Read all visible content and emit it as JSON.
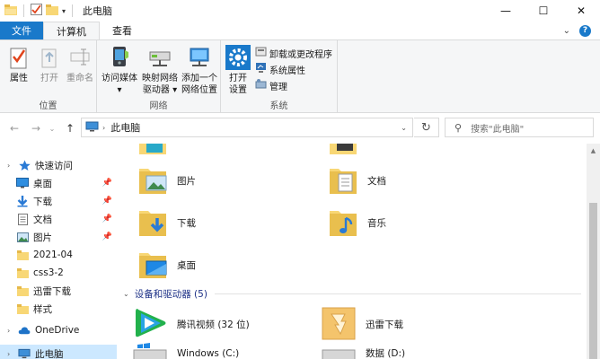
{
  "window": {
    "title": "此电脑",
    "minimize": "—",
    "maximize": "☐",
    "close": "✕"
  },
  "ribbon_tabs": [
    {
      "label": "文件"
    },
    {
      "label": "计算机"
    },
    {
      "label": "查看"
    }
  ],
  "ribbon": {
    "location_group": {
      "label": "位置",
      "buttons": [
        {
          "label": "属性"
        },
        {
          "label": "打开"
        },
        {
          "label": "重命名"
        }
      ]
    },
    "network_group": {
      "label": "网络",
      "buttons": [
        {
          "label_line1": "访问媒体",
          "label_line2": "▾"
        },
        {
          "label_line1": "映射网络",
          "label_line2": "驱动器 ▾"
        },
        {
          "label_line1": "添加一个",
          "label_line2": "网络位置"
        }
      ]
    },
    "system_group": {
      "label": "系统",
      "open_settings_line1": "打开",
      "open_settings_line2": "设置",
      "small_buttons": [
        {
          "label": "卸载或更改程序"
        },
        {
          "label": "系统属性"
        },
        {
          "label": "管理"
        }
      ]
    }
  },
  "address_bar": {
    "path": "此电脑",
    "search_placeholder": "搜索\"此电脑\""
  },
  "nav_pane": {
    "items": [
      {
        "label": "快速访问",
        "icon": "star-icon"
      },
      {
        "label": "桌面",
        "icon": "desktop-icon",
        "pinned": true
      },
      {
        "label": "下载",
        "icon": "download-icon",
        "pinned": true
      },
      {
        "label": "文档",
        "icon": "document-icon",
        "pinned": true
      },
      {
        "label": "图片",
        "icon": "picture-icon",
        "pinned": true
      },
      {
        "label": "2021-04",
        "icon": "folder-icon"
      },
      {
        "label": "css3-2",
        "icon": "folder-icon"
      },
      {
        "label": "迅雷下载",
        "icon": "folder-icon"
      },
      {
        "label": "样式",
        "icon": "folder-icon"
      },
      {
        "label": "OneDrive",
        "icon": "cloud-icon"
      },
      {
        "label": "此电脑",
        "icon": "computer-icon"
      }
    ],
    "pin_glyph": "📌"
  },
  "content": {
    "folders": [
      {
        "label": "图片"
      },
      {
        "label": "文档"
      },
      {
        "label": "下载"
      },
      {
        "label": "音乐"
      },
      {
        "label": "桌面"
      }
    ],
    "devices_header": "设备和驱动器 (5)",
    "devices": [
      {
        "label": "腾讯视频 (32 位)"
      },
      {
        "label": "迅雷下载"
      },
      {
        "label": "Windows (C:)"
      },
      {
        "label": "数据 (D:)"
      }
    ]
  },
  "colors": {
    "accent": "#1979ca",
    "selected_bg": "#cce8ff",
    "folder_yellow": "#f8d775",
    "section_header": "#1e3287"
  }
}
